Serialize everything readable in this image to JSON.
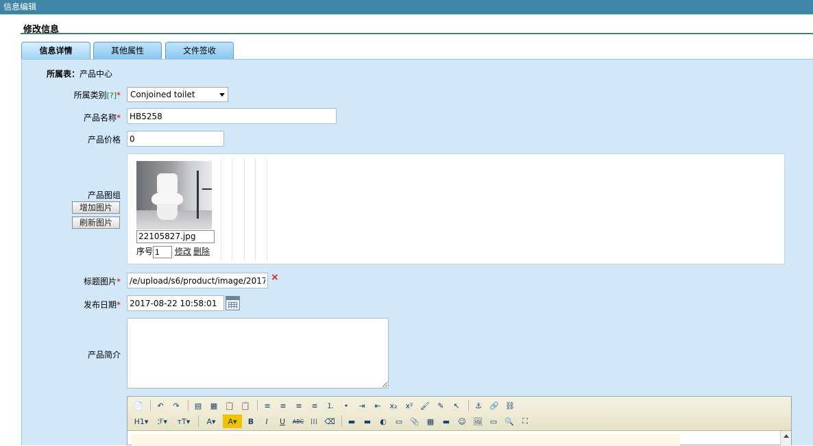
{
  "window": {
    "title": "信息编辑"
  },
  "section": {
    "title": "修改信息"
  },
  "tabs": [
    {
      "label": "信息详情",
      "active": true
    },
    {
      "label": "其他属性",
      "active": false
    },
    {
      "label": "文件签收",
      "active": false
    }
  ],
  "form": {
    "table": {
      "label": "所属表：",
      "value": "产品中心"
    },
    "category": {
      "label": "所属类别",
      "help": "[?]",
      "required": "*",
      "value": "Conjoined toilet"
    },
    "name": {
      "label": "产品名称",
      "required": "*",
      "value": "HB5258"
    },
    "price": {
      "label": "产品价格",
      "value": "0"
    },
    "gallery": {
      "label": "产品图组",
      "add_button": "增加图片",
      "refresh_button": "刷新图片",
      "images": [
        {
          "filename": "22105827.jpg",
          "seq_label": "序号",
          "seq": "1",
          "edit": "修改",
          "delete": "删除"
        }
      ]
    },
    "title_image": {
      "label": "标题图片",
      "required": "*",
      "value": "/e/upload/s6/product/image/2017/",
      "clear_icon": "×"
    },
    "publish_date": {
      "label": "发布日期",
      "required": "*",
      "value": "2017-08-22 10:58:01"
    },
    "intro": {
      "label": "产品简介",
      "value": ""
    }
  },
  "editor": {
    "row1": [
      "📄",
      "↶",
      "↷",
      "▤",
      "▦",
      "📋",
      "📋",
      "≡",
      "≡",
      "≡",
      "≡",
      "⒈",
      "•",
      "⇥",
      "⇤",
      "x₂",
      "x²",
      "🖌",
      "✎",
      "↖",
      "⚓",
      "🔗",
      "⛓"
    ],
    "row2": [
      "H1▾",
      "ℱ▾",
      "ᴛT▾",
      "A▾",
      "A▾",
      "B",
      "I",
      "U",
      "ABC",
      "⁞⁞⁞",
      "⌫",
      "▬",
      "▬",
      "◐",
      "▭",
      "📎",
      "▦",
      "▬",
      "☺",
      "🖼",
      "▭",
      "🔍",
      "⛶"
    ]
  },
  "colors": {
    "titlebar": "#3f85a8",
    "panel": "#d2e8f9",
    "accent_line": "#2f8a68",
    "required": "#dd0000"
  }
}
